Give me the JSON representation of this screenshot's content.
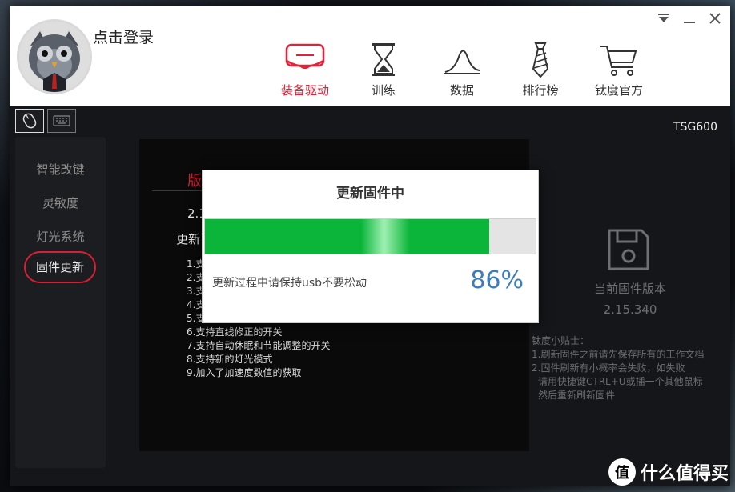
{
  "header": {
    "login": "点击登录",
    "nav": [
      {
        "label": "装备驱动",
        "icon": "drive-icon",
        "active": true
      },
      {
        "label": "训练",
        "icon": "hourglass-icon",
        "active": false
      },
      {
        "label": "数据",
        "icon": "curve-chart-icon",
        "active": false
      },
      {
        "label": "排行榜",
        "icon": "tie-icon",
        "active": false
      },
      {
        "label": "钛度官方",
        "icon": "shopping-cart-icon",
        "active": false
      }
    ],
    "window_controls": [
      "dropdown-icon",
      "minimize-icon",
      "close-icon"
    ]
  },
  "device": {
    "model": "TSG600",
    "tabs": [
      "mouse-icon",
      "keyboard-icon"
    ]
  },
  "sidebar": {
    "items": [
      {
        "label": "智能改键",
        "active": false
      },
      {
        "label": "灵敏度",
        "active": false
      },
      {
        "label": "灯光系统",
        "active": false
      },
      {
        "label": "固件更新",
        "active": true
      }
    ]
  },
  "content": {
    "version_title": "版",
    "version_num": "2.1",
    "update_head": "更新",
    "features": [
      "1.支",
      "2.支",
      "3.支",
      "4.支",
      "5.支",
      "6.支持直线修正的开关",
      "7.支持自动休眠和节能调整的开关",
      "8.支持新的灯光模式",
      "9.加入了加速度数值的获取"
    ]
  },
  "firmware": {
    "current_label": "当前固件版本",
    "current_version": "2.15.340",
    "tips": [
      "钛度小贴士：",
      "1.刷新固件之前请先保存所有的工作文档",
      "2.固件刷新有小概率会失败，如失败",
      "  请用快捷键CTRL+U或插一个其他鼠标",
      "  然后重新刷新固件"
    ]
  },
  "modal": {
    "title": "更新固件中",
    "progress": 0.86,
    "percent_text": "86%",
    "message": "更新过程中请保持usb不要松动"
  },
  "watermark": {
    "logo_char": "值",
    "text": "什么值得买"
  },
  "colors": {
    "accent": "#d62036",
    "progress": "#0bb53a",
    "percent": "#3b7dbf"
  }
}
